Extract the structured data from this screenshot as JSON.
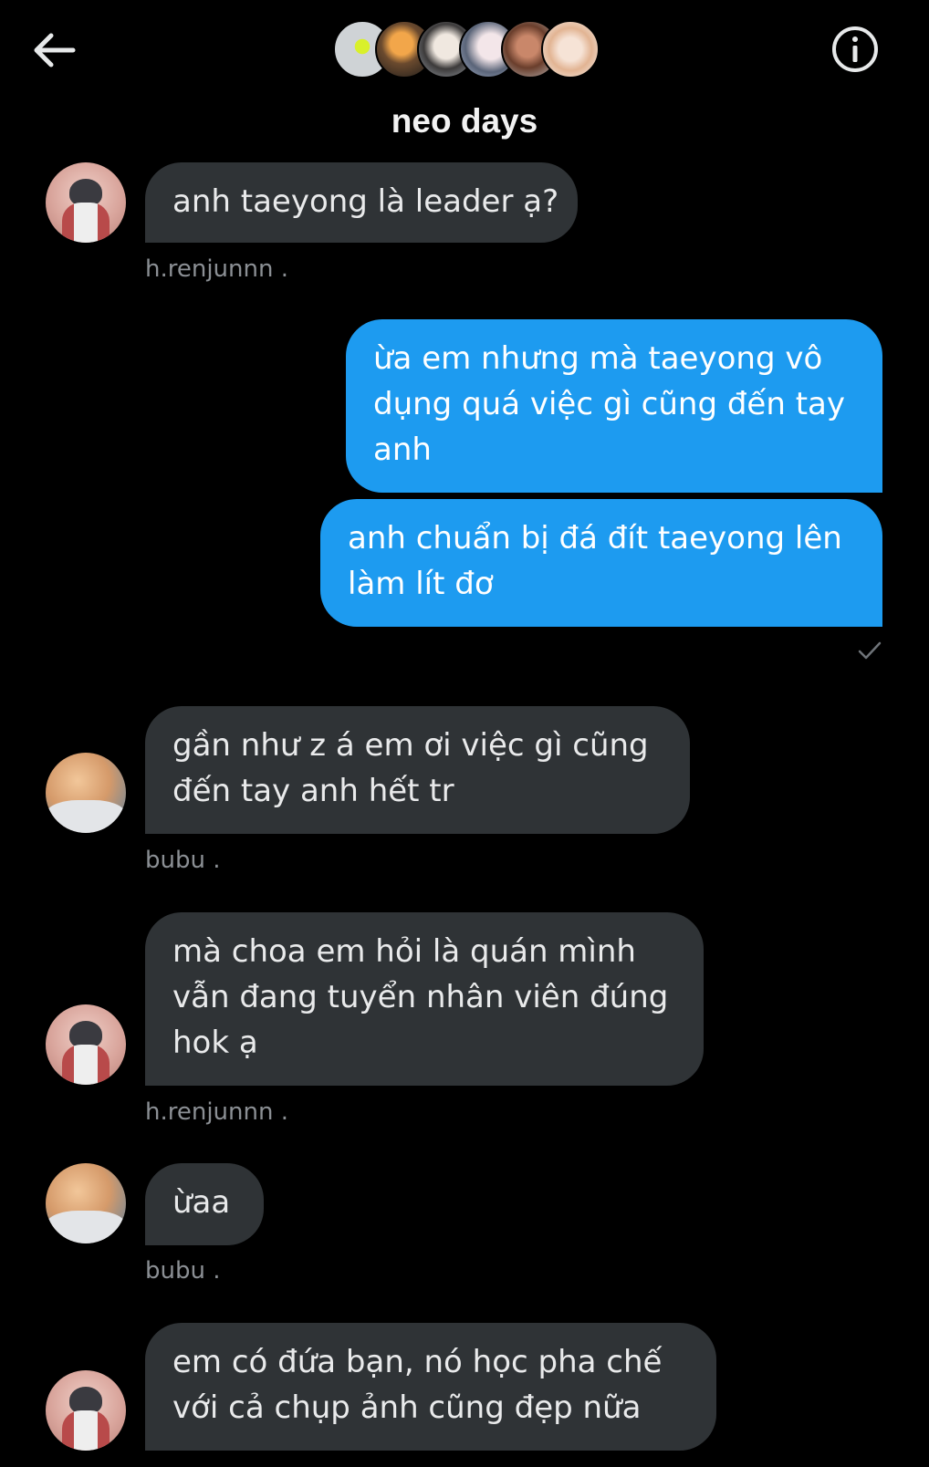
{
  "header": {
    "title": "neo days",
    "back_icon": "arrow-left-icon",
    "info_icon": "info-circle-icon"
  },
  "colors": {
    "background": "#000000",
    "incoming_bubble": "#2f3336",
    "outgoing_bubble": "#1d9bf0",
    "meta_text": "#8b8f94"
  },
  "messages": [
    {
      "sender": "h.renjunnn",
      "direction": "in",
      "lines": [
        "anh taeyong là leader ạ?"
      ],
      "meta": "h.renjunnn ."
    },
    {
      "direction": "out",
      "lines": [
        "ừa em nhưng mà taeyong vô",
        "dụng quá việc gì cũng đến tay",
        "anh"
      ]
    },
    {
      "direction": "out",
      "lines": [
        "anh chuẩn bị đá đít taeyong lên",
        "làm lít đơ"
      ],
      "status_icon": "checkmark-icon"
    },
    {
      "sender": "bubu",
      "direction": "in",
      "lines": [
        "gần như z á em ơi việc gì cũng",
        "đến tay anh hết tr"
      ],
      "meta": "bubu ."
    },
    {
      "sender": "h.renjunnn",
      "direction": "in",
      "lines": [
        "mà choa em hỏi là quán mình",
        "vẫn đang tuyển nhân viên đúng",
        "hok ạ"
      ],
      "meta": "h.renjunnn ."
    },
    {
      "sender": "bubu",
      "direction": "in",
      "lines": [
        "ừaa"
      ],
      "meta": "bubu ."
    },
    {
      "sender": "h.renjunnn",
      "direction": "in",
      "lines": [
        "em có đứa bạn, nó học pha chế",
        "với cả chụp ảnh cũng đẹp nữa"
      ]
    }
  ]
}
